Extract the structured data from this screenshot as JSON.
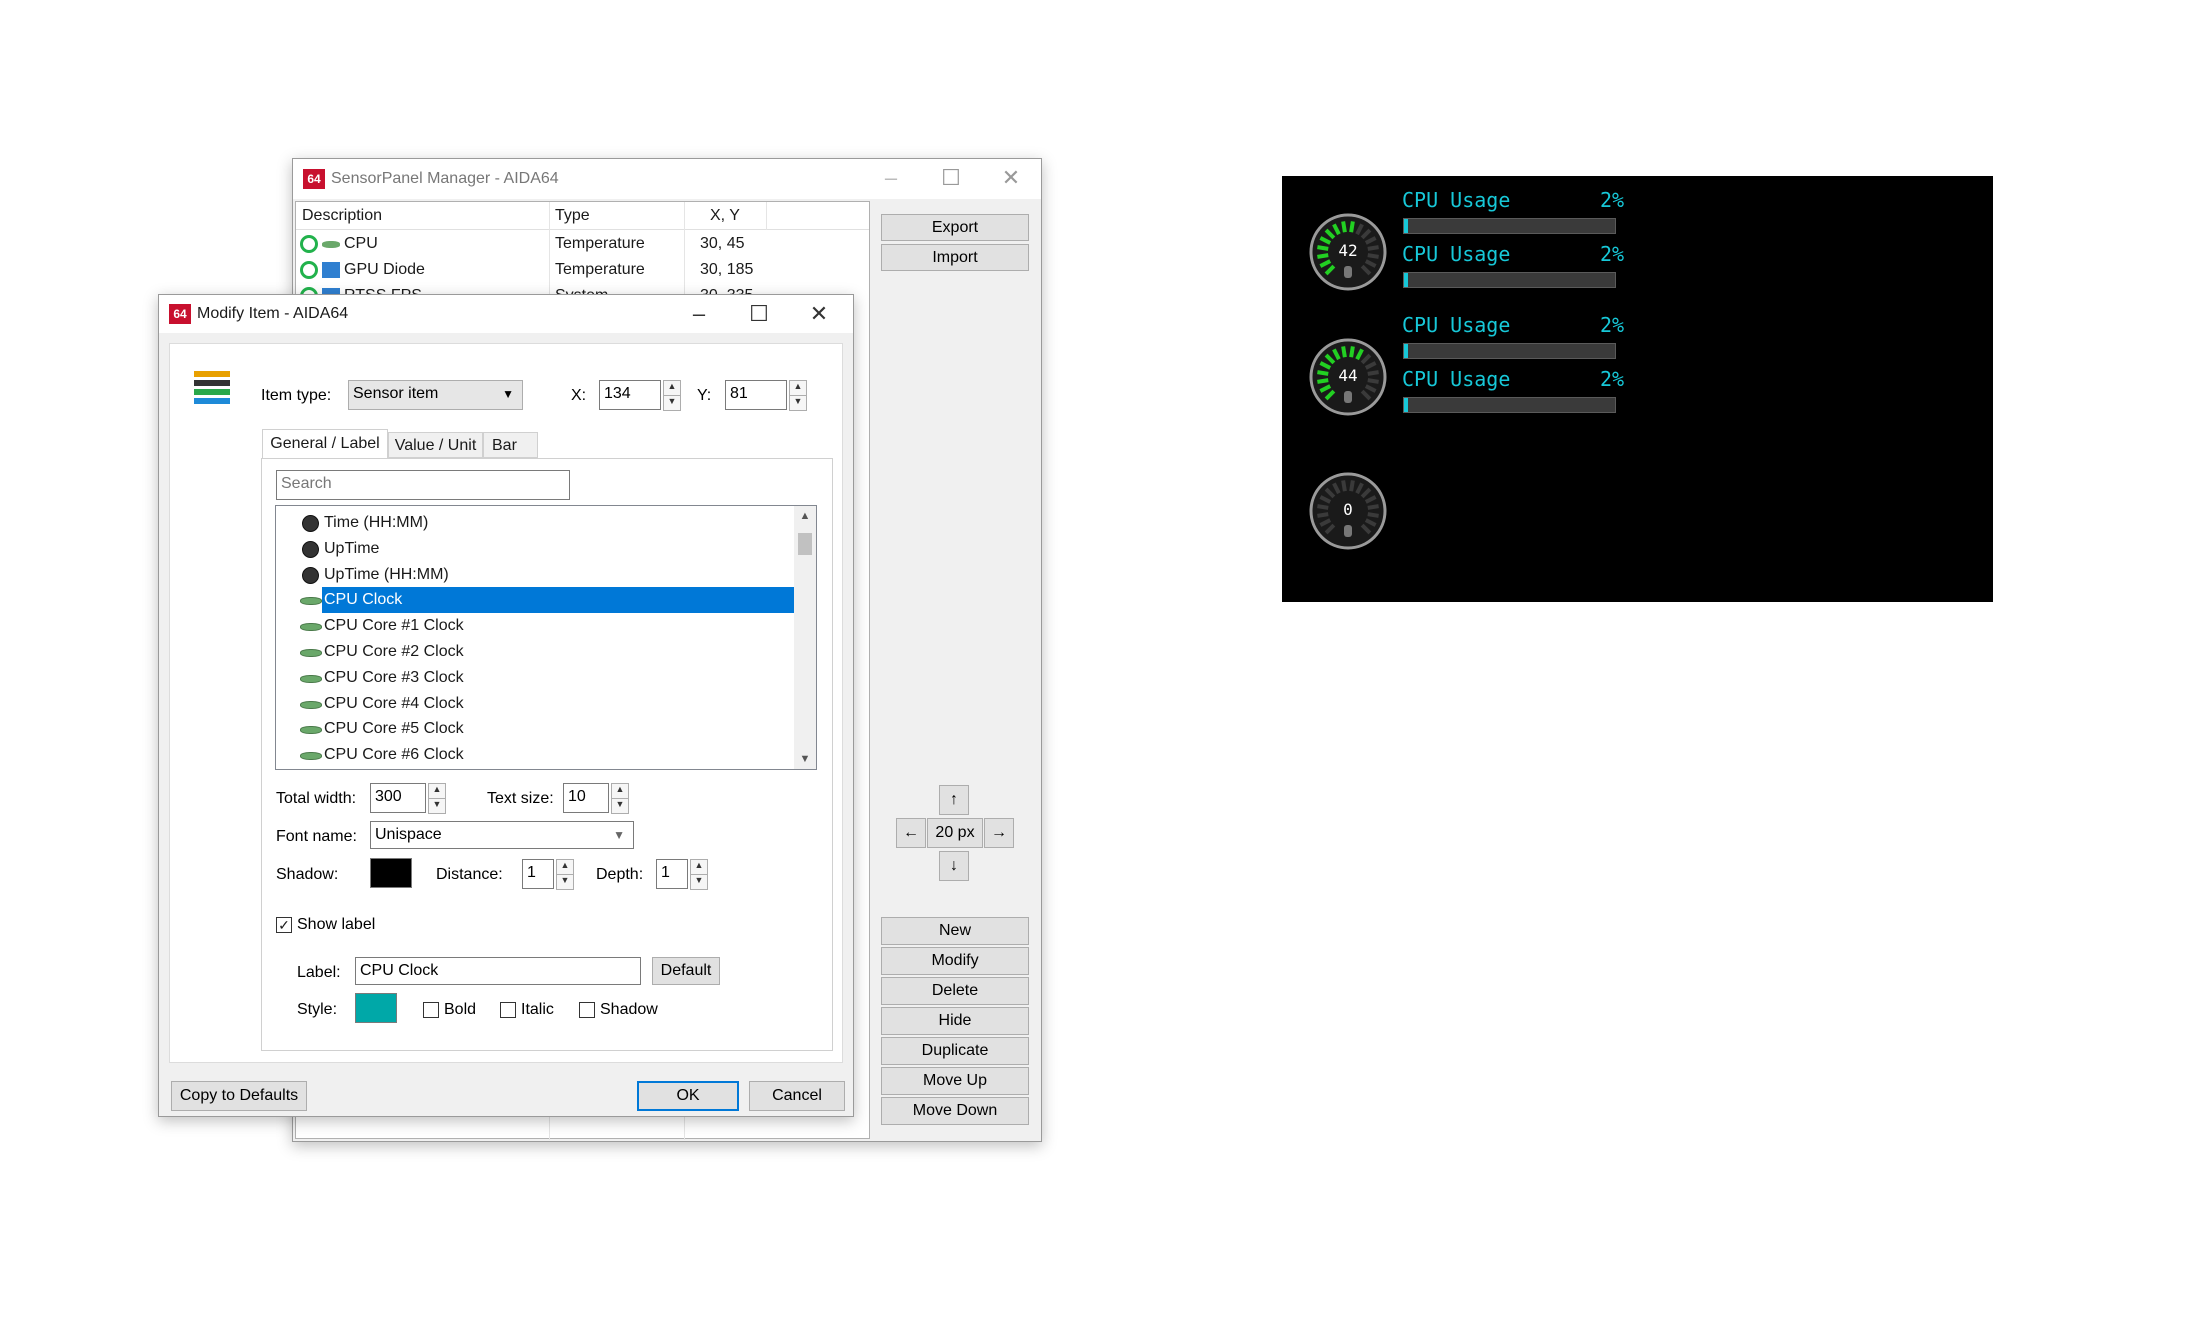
{
  "manager": {
    "title": "SensorPanel Manager - AIDA64",
    "app_icon": "64",
    "columns": [
      "Description",
      "Type",
      "X, Y"
    ],
    "rows": [
      {
        "description": "CPU",
        "type": "Temperature",
        "xy": "30, 45"
      },
      {
        "description": "GPU Diode",
        "type": "Temperature",
        "xy": "30, 185"
      },
      {
        "description": "RTSS FPS",
        "type": "System",
        "xy": "30, 335"
      }
    ],
    "buttons": {
      "export": "Export",
      "import": "Import",
      "new": "New",
      "modify": "Modify",
      "delete": "Delete",
      "hide": "Hide",
      "duplicate": "Duplicate",
      "move_up": "Move Up",
      "move_down": "Move Down"
    },
    "nudge": {
      "step": "20 px"
    },
    "window_controls": {
      "minimize": "–",
      "maximize": "☐",
      "close": "✕"
    }
  },
  "modify": {
    "title": "Modify Item - AIDA64",
    "app_icon": "64",
    "window_controls": {
      "minimize": "–",
      "maximize": "☐",
      "close": "✕"
    },
    "item_type_label": "Item type:",
    "item_type_value": "Sensor item",
    "x_label": "X:",
    "x_value": "134",
    "y_label": "Y:",
    "y_value": "81",
    "tabs": [
      "General / Label",
      "Value / Unit",
      "Bar"
    ],
    "search_placeholder": "Search",
    "tree_items": [
      {
        "label": "Time (HH:MM)",
        "icon": "clock-icon"
      },
      {
        "label": "UpTime",
        "icon": "clock-icon"
      },
      {
        "label": "UpTime (HH:MM)",
        "icon": "clock-icon"
      },
      {
        "label": "CPU Clock",
        "icon": "cpu-icon",
        "selected": true
      },
      {
        "label": "CPU Core #1 Clock",
        "icon": "cpu-icon"
      },
      {
        "label": "CPU Core #2 Clock",
        "icon": "cpu-icon"
      },
      {
        "label": "CPU Core #3 Clock",
        "icon": "cpu-icon"
      },
      {
        "label": "CPU Core #4 Clock",
        "icon": "cpu-icon"
      },
      {
        "label": "CPU Core #5 Clock",
        "icon": "cpu-icon"
      },
      {
        "label": "CPU Core #6 Clock",
        "icon": "cpu-icon"
      }
    ],
    "total_width_label": "Total width:",
    "total_width_value": "300",
    "text_size_label": "Text size:",
    "text_size_value": "10",
    "font_name_label": "Font name:",
    "font_name_value": "Unispace",
    "shadow_label": "Shadow:",
    "shadow_color": "#000000",
    "distance_label": "Distance:",
    "distance_value": "1",
    "depth_label": "Depth:",
    "depth_value": "1",
    "show_label_text": "Show label",
    "show_label_checked": true,
    "label_label": "Label:",
    "label_value": "CPU Clock",
    "default_button": "Default",
    "style_label": "Style:",
    "style_color": "#00a8a8",
    "bold_label": "Bold",
    "italic_label": "Italic",
    "shadow_style_label": "Shadow",
    "copy_defaults": "Copy to Defaults",
    "ok": "OK",
    "cancel": "Cancel"
  },
  "panel": {
    "gauges": [
      {
        "value": "42",
        "icon": "thermometer-icon",
        "fill": 0.55
      },
      {
        "value": "44",
        "icon": "thermometer-icon",
        "fill": 0.6
      },
      {
        "value": "0",
        "icon": "fan-icon",
        "fill": 0
      }
    ],
    "bars": [
      {
        "label": "CPU Usage",
        "value": "2%",
        "fill": 0.02
      },
      {
        "label": "CPU Usage",
        "value": "2%",
        "fill": 0.02
      },
      {
        "label": "CPU Usage",
        "value": "2%",
        "fill": 0.02
      },
      {
        "label": "CPU Usage",
        "value": "2%",
        "fill": 0.02
      }
    ],
    "accent": "#17c8d8",
    "gauge_color": "#22d022"
  }
}
